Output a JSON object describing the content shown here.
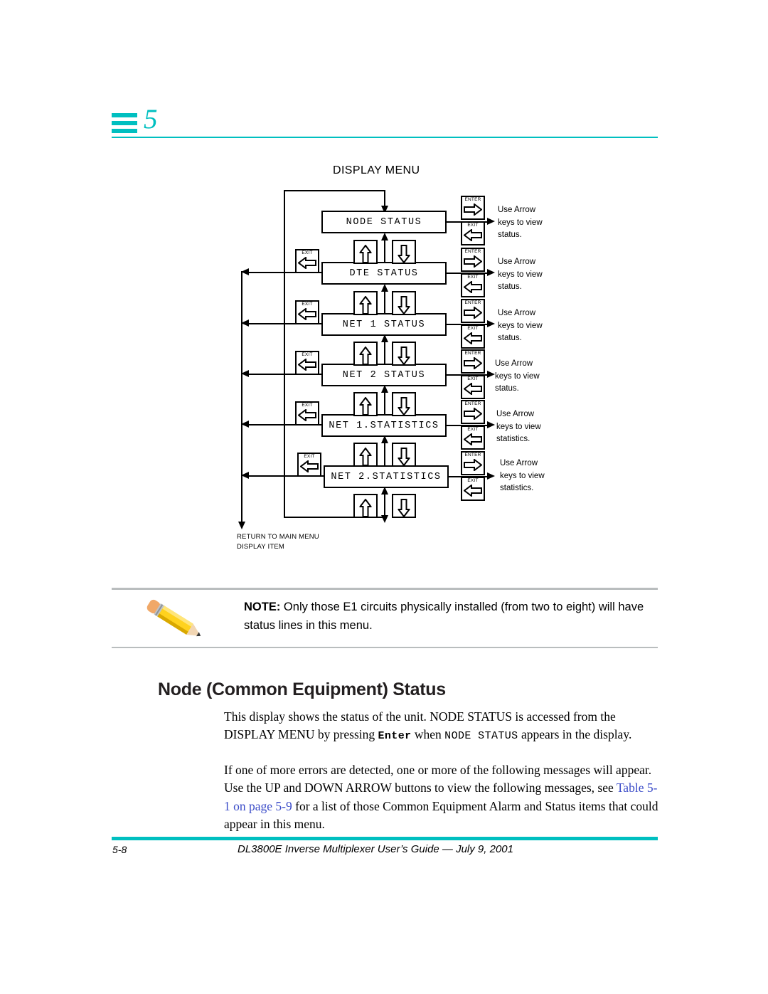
{
  "chapter": {
    "number": "5",
    "accent_color": "#00BFC0",
    "bars_icon": "chapter-bars-icon"
  },
  "diagram": {
    "title": "DISPLAY MENU",
    "return_caption_line1": "RETURN TO MAIN MENU",
    "return_caption_line2": "DISPLAY ITEM",
    "key_labels": {
      "enter": "ENTER",
      "exit": "EXIT"
    },
    "rows": [
      {
        "menu_item": "NODE STATUS",
        "hint_line1": "Use Arrow",
        "hint_line2": "keys to view",
        "hint_line3": "status.",
        "has_exit_left": false
      },
      {
        "menu_item": "DTE STATUS",
        "hint_line1": "Use Arrow",
        "hint_line2": "keys to view",
        "hint_line3": "status.",
        "has_exit_left": true
      },
      {
        "menu_item": "NET 1 STATUS",
        "hint_line1": "Use Arrow",
        "hint_line2": "keys to view",
        "hint_line3": "status.",
        "has_exit_left": true
      },
      {
        "menu_item": "NET 2 STATUS",
        "hint_line1": "Use Arrow",
        "hint_line2": "keys to view",
        "hint_line3": "status.",
        "has_exit_left": true
      },
      {
        "menu_item": "NET 1.STATISTICS",
        "hint_line1": "Use Arrow",
        "hint_line2": "keys to view",
        "hint_line3": "statistics.",
        "has_exit_left": true
      },
      {
        "menu_item": "NET 2.STATISTICS",
        "hint_line1": "Use Arrow",
        "hint_line2": "keys to view",
        "hint_line3": "statistics.",
        "has_exit_left": true
      }
    ]
  },
  "note": {
    "label": "NOTE:",
    "text": " Only those E1 circuits physically installed (from two to eight) will have status lines in this menu.",
    "icon": "pencil-icon",
    "rule_color": "#B9BDBE"
  },
  "section": {
    "heading": "Node (Common Equipment) Status",
    "paragraph1": {
      "part1": "This display shows the status of the unit. NODE STATUS is accessed from the DISPLAY MENU by pressing ",
      "mono_bold": "Enter",
      "part2": " when ",
      "mono": "NODE STATUS",
      "part3": " appears in the display."
    },
    "paragraph2": {
      "part1": "If one of more errors are detected, one or more of the following messages will appear. Use the UP and DOWN ARROW buttons to view the following messages, see ",
      "xref": "Table 5-1 on page 5-9",
      "part2": " for a list of those Common Equipment Alarm and Status items that could appear in this menu.",
      "xref_color": "#3b4cc8"
    }
  },
  "footer": {
    "page_number": "5-8",
    "title": "DL3800E Inverse Multiplexer User’s Guide — July 9, 2001",
    "rule_color": "#00BFC0"
  }
}
